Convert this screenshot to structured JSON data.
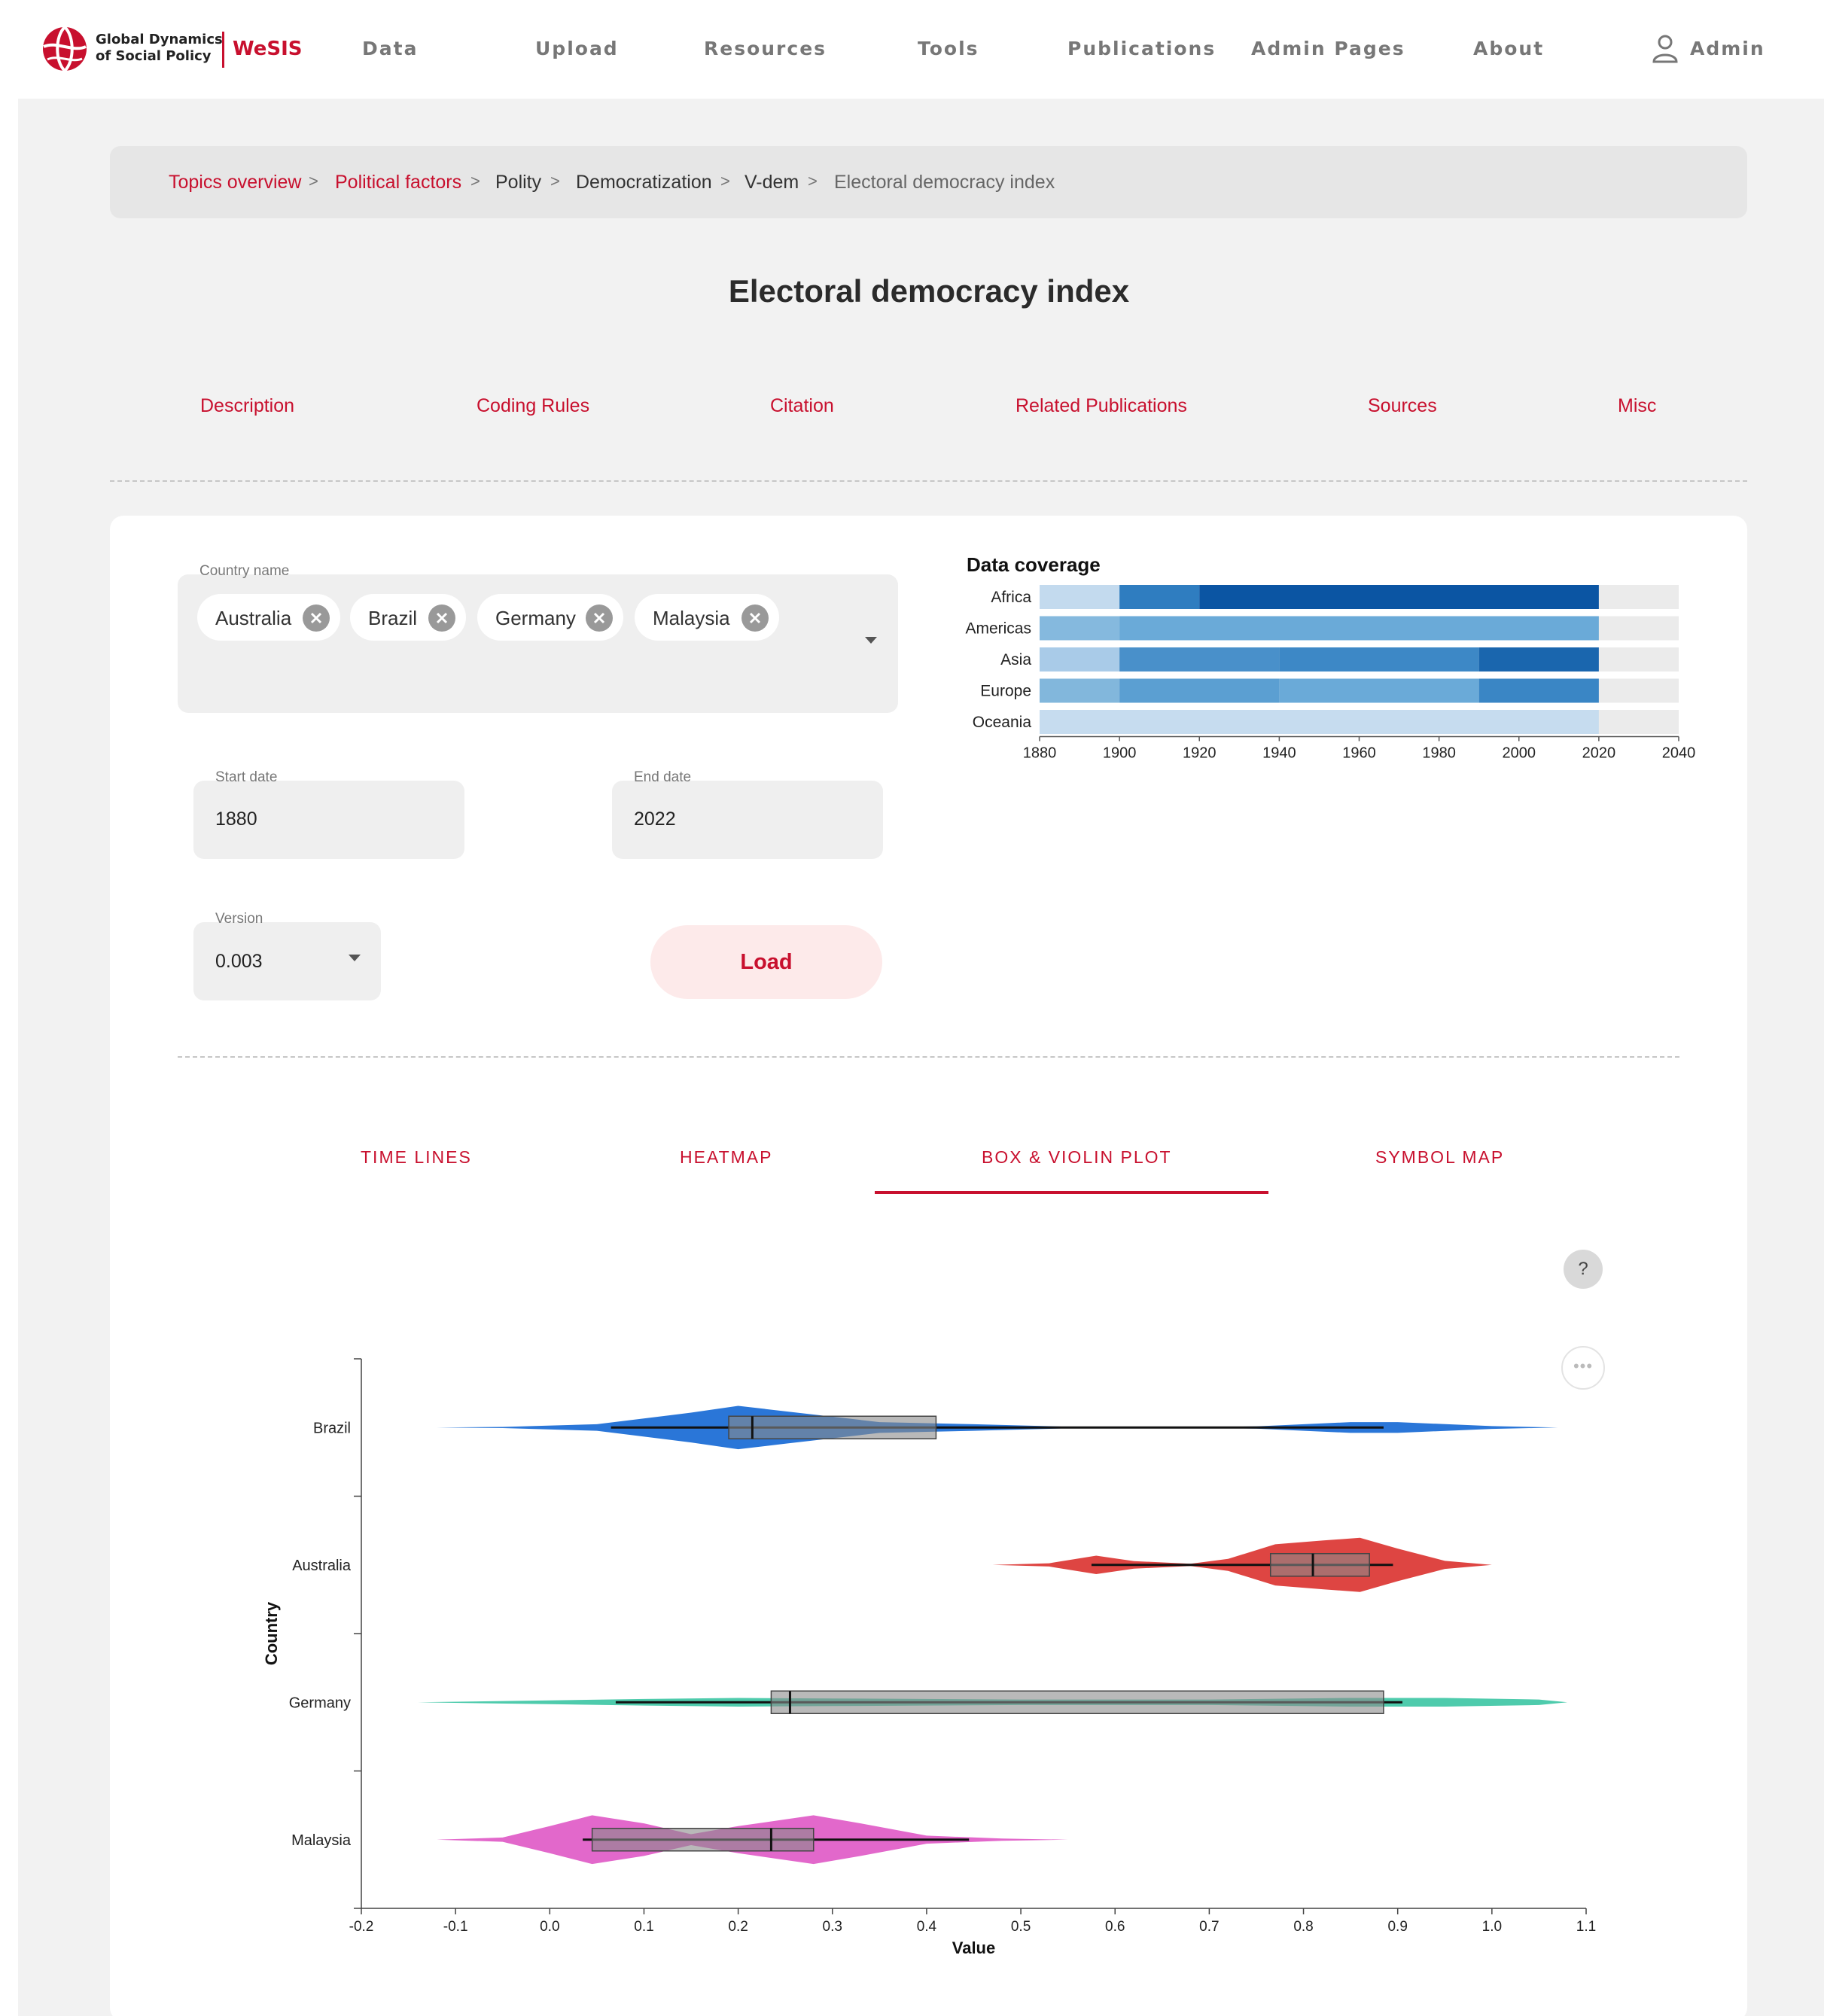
{
  "header": {
    "logo_line1": "Global Dynamics",
    "logo_line2": "of Social Policy",
    "logo_brand": "WeSIS",
    "nav": [
      "Data",
      "Upload",
      "Resources",
      "Tools",
      "Publications",
      "Admin Pages",
      "About"
    ],
    "user_label": "Admin"
  },
  "breadcrumb": {
    "items": [
      "Topics overview",
      "Political factors",
      "Polity",
      "Democratization",
      "V-dem",
      "Electoral democracy index"
    ],
    "separator": ">"
  },
  "page": {
    "title": "Electoral democracy index",
    "subtabs": [
      "Description",
      "Coding Rules",
      "Citation",
      "Related Publications",
      "Sources",
      "Misc"
    ]
  },
  "form": {
    "country_label": "Country name",
    "countries": [
      "Australia",
      "Brazil",
      "Germany",
      "Malaysia"
    ],
    "start_label": "Start date",
    "start_value": "1880",
    "end_label": "End date",
    "end_value": "2022",
    "version_label": "Version",
    "version_value": "0.003",
    "load_label": "Load"
  },
  "coverage": {
    "title": "Data coverage",
    "regions": [
      "Africa",
      "Americas",
      "Asia",
      "Europe",
      "Oceania"
    ],
    "ticks": [
      "1880",
      "1900",
      "1920",
      "1940",
      "1960",
      "1980",
      "2000",
      "2020",
      "2040"
    ],
    "x_range": [
      1880,
      2040
    ],
    "data_range": [
      1880,
      2020
    ],
    "segments": [
      [
        {
          "from": 1880,
          "to": 1900,
          "color": "#c3daee"
        },
        {
          "from": 1900,
          "to": 1920,
          "color": "#2f7dc0"
        },
        {
          "from": 1920,
          "to": 2020,
          "color": "#0b55a3"
        }
      ],
      [
        {
          "from": 1880,
          "to": 1900,
          "color": "#85b9de"
        },
        {
          "from": 1900,
          "to": 2020,
          "color": "#6aaad8"
        }
      ],
      [
        {
          "from": 1880,
          "to": 1900,
          "color": "#a9cbe8"
        },
        {
          "from": 1900,
          "to": 1940,
          "color": "#4990ca"
        },
        {
          "from": 1940,
          "to": 1990,
          "color": "#3d88c6"
        },
        {
          "from": 1990,
          "to": 2020,
          "color": "#1a66ae"
        }
      ],
      [
        {
          "from": 1880,
          "to": 1900,
          "color": "#82b7dc"
        },
        {
          "from": 1900,
          "to": 1940,
          "color": "#5b9fd2"
        },
        {
          "from": 1940,
          "to": 1990,
          "color": "#6aaad8"
        },
        {
          "from": 1990,
          "to": 2020,
          "color": "#3a86c5"
        }
      ],
      [
        {
          "from": 1880,
          "to": 2020,
          "color": "#c6dcef"
        }
      ]
    ]
  },
  "viz_tabs": {
    "items": [
      "TIME LINES",
      "HEATMAP",
      "BOX & VIOLIN PLOT",
      "SYMBOL MAP"
    ],
    "active": "BOX & VIOLIN PLOT"
  },
  "help_label": "?",
  "more_label": "•••",
  "chart_data": {
    "type": "box-violin",
    "xlabel": "Value",
    "ylabel": "Country",
    "xlim": [
      -0.2,
      1.1
    ],
    "xticks": [
      "-0.2",
      "-0.1",
      "0.0",
      "0.1",
      "0.2",
      "0.3",
      "0.4",
      "0.5",
      "0.6",
      "0.7",
      "0.8",
      "0.9",
      "1.0",
      "1.1"
    ],
    "categories": [
      "Brazil",
      "Australia",
      "Germany",
      "Malaysia"
    ],
    "series": [
      {
        "name": "Brazil",
        "color": "#1f6fd6",
        "whisker_low": 0.065,
        "q1": 0.19,
        "median": 0.215,
        "q3": 0.41,
        "whisker_high": 0.885,
        "violin": [
          [
            -0.12,
            0.0
          ],
          [
            -0.05,
            0.02
          ],
          [
            0.05,
            0.12
          ],
          [
            0.15,
            0.55
          ],
          [
            0.2,
            0.8
          ],
          [
            0.25,
            0.6
          ],
          [
            0.35,
            0.2
          ],
          [
            0.45,
            0.12
          ],
          [
            0.55,
            0.03
          ],
          [
            0.65,
            0.01
          ],
          [
            0.75,
            0.04
          ],
          [
            0.85,
            0.2
          ],
          [
            0.9,
            0.2
          ],
          [
            1.0,
            0.05
          ],
          [
            1.07,
            0.0
          ]
        ]
      },
      {
        "name": "Australia",
        "color": "#dc3b38",
        "whisker_low": 0.575,
        "q1": 0.765,
        "median": 0.81,
        "q3": 0.87,
        "whisker_high": 0.895,
        "violin": [
          [
            0.47,
            0.0
          ],
          [
            0.53,
            0.06
          ],
          [
            0.58,
            0.34
          ],
          [
            0.62,
            0.14
          ],
          [
            0.68,
            0.04
          ],
          [
            0.72,
            0.22
          ],
          [
            0.77,
            0.76
          ],
          [
            0.82,
            0.9
          ],
          [
            0.86,
            1.0
          ],
          [
            0.9,
            0.6
          ],
          [
            0.95,
            0.15
          ],
          [
            1.0,
            0.0
          ]
        ]
      },
      {
        "name": "Germany",
        "color": "#44c8a8",
        "whisker_low": 0.07,
        "q1": 0.235,
        "median": 0.255,
        "q3": 0.885,
        "whisker_high": 0.905,
        "violin": [
          [
            -0.14,
            0.0
          ],
          [
            0.0,
            0.07
          ],
          [
            0.1,
            0.12
          ],
          [
            0.2,
            0.16
          ],
          [
            0.3,
            0.14
          ],
          [
            0.5,
            0.1
          ],
          [
            0.7,
            0.1
          ],
          [
            0.85,
            0.16
          ],
          [
            0.95,
            0.16
          ],
          [
            1.05,
            0.1
          ],
          [
            1.08,
            0.0
          ]
        ]
      },
      {
        "name": "Malaysia",
        "color": "#e060c8",
        "whisker_low": 0.035,
        "q1": 0.045,
        "median": 0.235,
        "q3": 0.28,
        "whisker_high": 0.445,
        "violin": [
          [
            -0.12,
            0.0
          ],
          [
            -0.05,
            0.08
          ],
          [
            0.0,
            0.5
          ],
          [
            0.045,
            0.9
          ],
          [
            0.1,
            0.6
          ],
          [
            0.15,
            0.2
          ],
          [
            0.2,
            0.5
          ],
          [
            0.28,
            0.9
          ],
          [
            0.33,
            0.6
          ],
          [
            0.4,
            0.15
          ],
          [
            0.48,
            0.04
          ],
          [
            0.55,
            0.0
          ]
        ]
      }
    ]
  }
}
